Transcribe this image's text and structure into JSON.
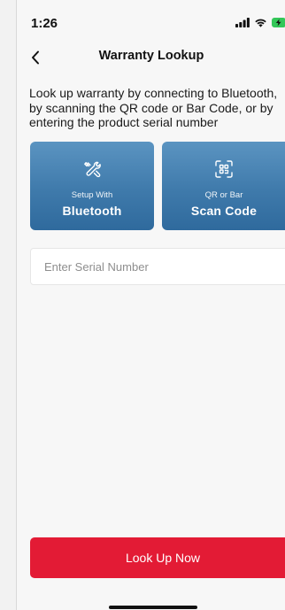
{
  "status_bar": {
    "time": "1:26"
  },
  "header": {
    "title": "Warranty Lookup",
    "back_icon": "chevron-left-icon"
  },
  "description": "Look up warranty by connecting to Bluetooth, by scanning the QR code or Bar Code, or by entering the product serial number",
  "tiles": [
    {
      "icon": "tools-icon",
      "sub_label": "Setup With",
      "main_label": "Bluetooth"
    },
    {
      "icon": "scan-code-icon",
      "sub_label": "QR or Bar",
      "main_label": "Scan Code"
    }
  ],
  "serial_input": {
    "value": "",
    "placeholder": "Enter Serial Number"
  },
  "lookup_button": {
    "label": "Look Up Now"
  },
  "colors": {
    "tile_blue": "#3f7aab",
    "button_red": "#e31b35",
    "battery_green": "#34c759"
  }
}
